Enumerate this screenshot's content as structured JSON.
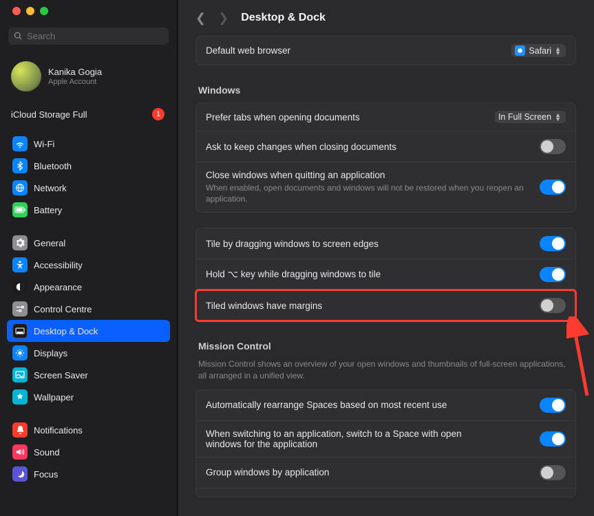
{
  "sidebar": {
    "search_placeholder": "Search",
    "account": {
      "name": "Kanika Gogia",
      "subtitle": "Apple Account"
    },
    "icloud_label": "iCloud Storage Full",
    "icloud_badge": "1",
    "items": [
      {
        "label": "Wi-Fi"
      },
      {
        "label": "Bluetooth"
      },
      {
        "label": "Network"
      },
      {
        "label": "Battery"
      },
      {
        "label": "General"
      },
      {
        "label": "Accessibility"
      },
      {
        "label": "Appearance"
      },
      {
        "label": "Control Centre"
      },
      {
        "label": "Desktop & Dock"
      },
      {
        "label": "Displays"
      },
      {
        "label": "Screen Saver"
      },
      {
        "label": "Wallpaper"
      },
      {
        "label": "Notifications"
      },
      {
        "label": "Sound"
      },
      {
        "label": "Focus"
      }
    ]
  },
  "header": {
    "title": "Desktop & Dock"
  },
  "browser": {
    "label": "Default web browser",
    "value": "Safari"
  },
  "windows": {
    "heading": "Windows",
    "prefer_tabs_label": "Prefer tabs when opening documents",
    "prefer_tabs_value": "In Full Screen",
    "ask_keep_label": "Ask to keep changes when closing documents",
    "close_windows_label": "Close windows when quitting an application",
    "close_windows_sub": "When enabled, open documents and windows will not be restored when you reopen an application.",
    "tile_drag_label": "Tile by dragging windows to screen edges",
    "hold_opt_label": "Hold ⌥ key while dragging windows to tile",
    "tiled_margins_label": "Tiled windows have margins"
  },
  "mission": {
    "heading": "Mission Control",
    "sub": "Mission Control shows an overview of your open windows and thumbnails of full-screen applications, all arranged in a unified view.",
    "auto_rearrange_label": "Automatically rearrange Spaces based on most recent use",
    "switch_space_label": "When switching to an application, switch to a Space with open windows for the application",
    "group_windows_label": "Group windows by application"
  },
  "switch_states": {
    "ask_keep": "off",
    "close_windows": "on",
    "tile_drag": "on",
    "hold_opt": "on",
    "tiled_margins": "off",
    "auto_rearrange": "on",
    "switch_space": "on",
    "group_windows": "off"
  },
  "colors": {
    "accent": "#0a84ff",
    "annotation": "#ff3b30"
  }
}
